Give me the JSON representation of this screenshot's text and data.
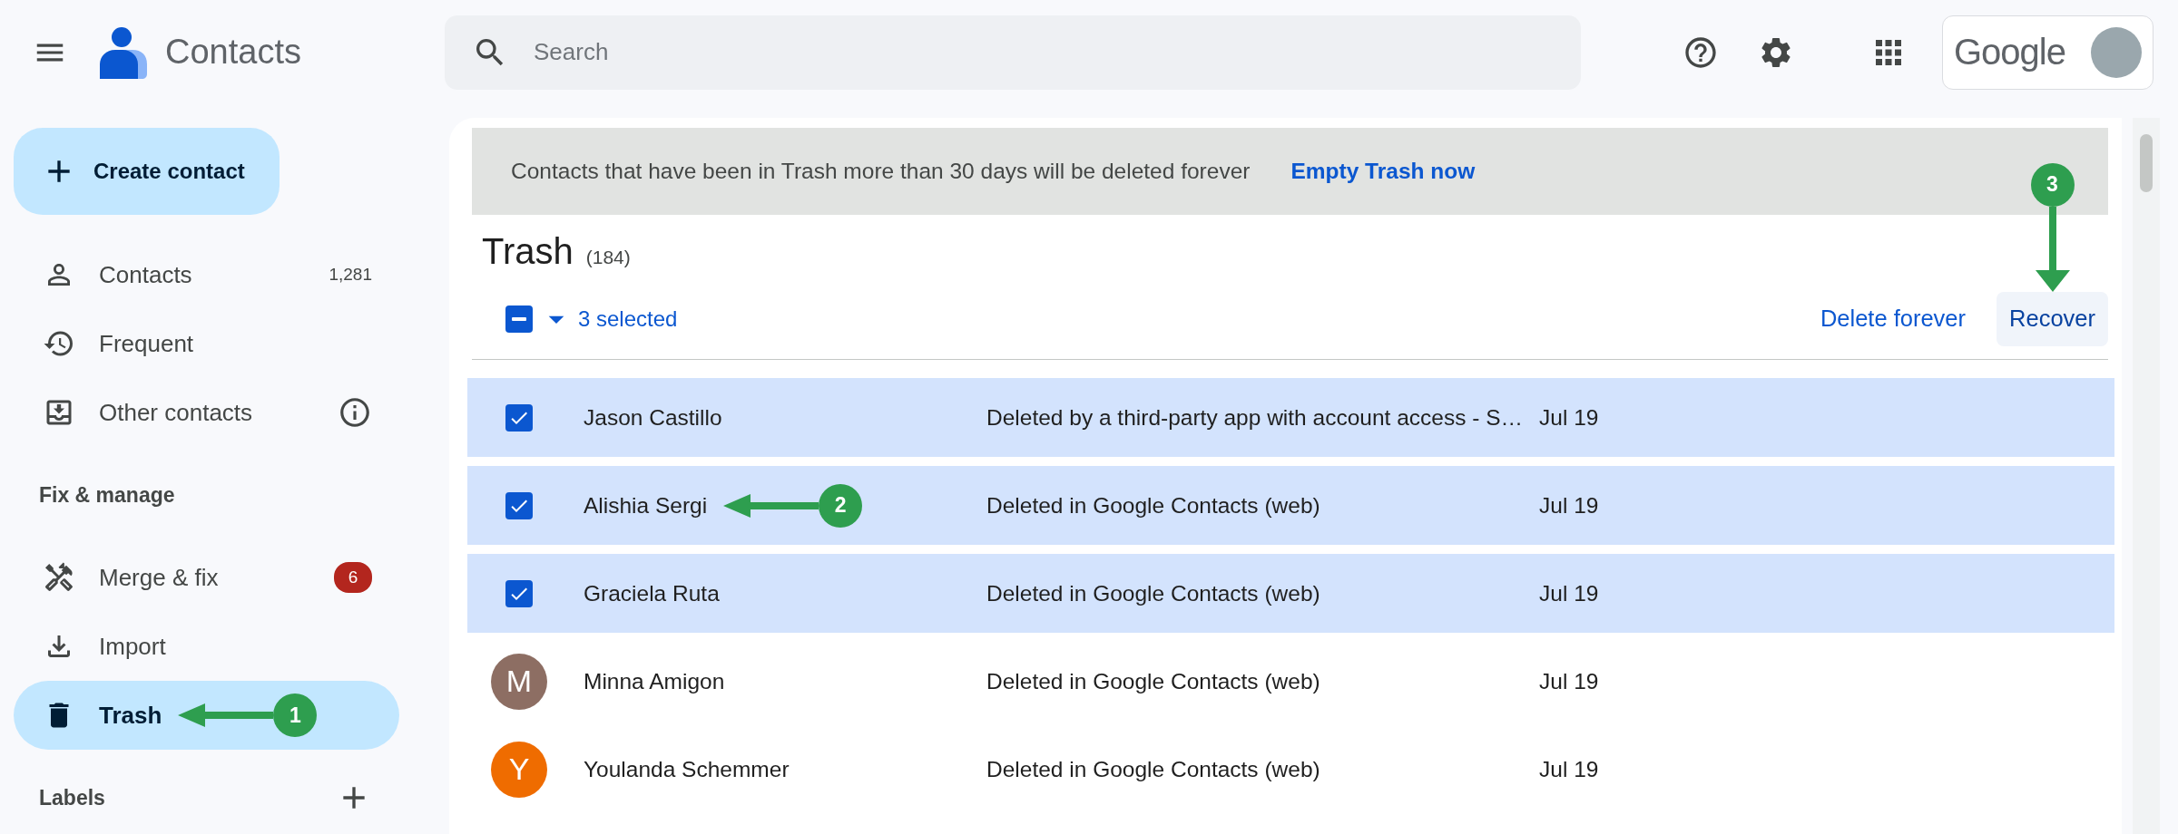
{
  "app": {
    "title": "Contacts"
  },
  "search": {
    "placeholder": "Search"
  },
  "account": {
    "logo_text": "Google"
  },
  "sidebar": {
    "create_label": "Create contact",
    "items": [
      {
        "label": "Contacts",
        "kind": "person",
        "count": "1,281",
        "selected": false
      },
      {
        "label": "Frequent",
        "kind": "history",
        "selected": false
      },
      {
        "label": "Other contacts",
        "kind": "inbox",
        "info": true,
        "selected": false
      }
    ],
    "manage_heading": "Fix & manage",
    "manage_items": [
      {
        "label": "Merge & fix",
        "kind": "tools",
        "badge": "6",
        "selected": false
      },
      {
        "label": "Import",
        "kind": "download",
        "selected": false
      },
      {
        "label": "Trash",
        "kind": "trash",
        "selected": true,
        "callout": "1"
      }
    ],
    "labels_heading": "Labels"
  },
  "main": {
    "banner": {
      "message": "Contacts that have been in Trash more than 30 days will be deleted forever",
      "action": "Empty Trash now"
    },
    "title": "Trash",
    "count": "(184)",
    "selection": {
      "indeterminate": true,
      "label": "3 selected"
    },
    "actions": [
      {
        "label": "Delete forever",
        "highlighted": false
      },
      {
        "label": "Recover",
        "highlighted": true,
        "callout": "3"
      }
    ],
    "rows": [
      {
        "name": "Jason Castillo",
        "reason": "Deleted by a third-party app with account access - S…",
        "date": "Jul 19",
        "selected": true
      },
      {
        "name": "Alishia Sergi",
        "reason": "Deleted in Google Contacts (web)",
        "date": "Jul 19",
        "selected": true,
        "callout": "2"
      },
      {
        "name": "Graciela Ruta",
        "reason": "Deleted in Google Contacts (web)",
        "date": "Jul 19",
        "selected": true
      },
      {
        "name": "Minna Amigon",
        "reason": "Deleted in Google Contacts (web)",
        "date": "Jul 19",
        "selected": false,
        "avatar": {
          "initial": "M",
          "color": "#8d6e63"
        }
      },
      {
        "name": "Youlanda Schemmer",
        "reason": "Deleted in Google Contacts (web)",
        "date": "Jul 19",
        "selected": false,
        "avatar": {
          "initial": "Y",
          "color": "#ef6c00"
        }
      }
    ]
  }
}
